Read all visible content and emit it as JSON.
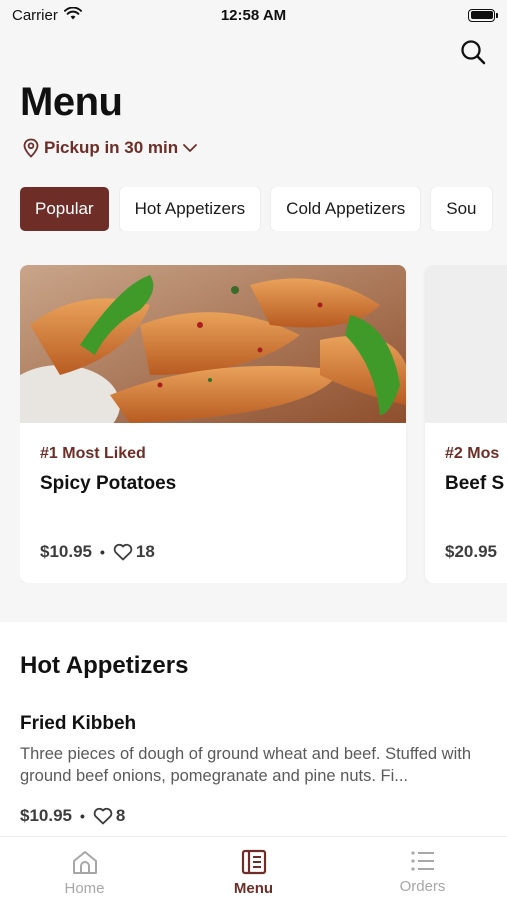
{
  "status_bar": {
    "carrier": "Carrier",
    "time": "12:58 AM",
    "battery_level": 1.0
  },
  "header": {
    "title": "Menu",
    "pickup_text": "Pickup in 30 min",
    "search_icon": "search-icon",
    "pickup_icon": "location-pin-icon"
  },
  "categories": [
    {
      "label": "Popular",
      "active": true
    },
    {
      "label": "Hot Appetizers",
      "active": false
    },
    {
      "label": "Cold Appetizers",
      "active": false
    },
    {
      "label": "Sou",
      "active": false
    }
  ],
  "featured": [
    {
      "rank": "#1 Most Liked",
      "name": "Spicy Potatoes",
      "price": "$10.95",
      "separator": "•",
      "likes": "18"
    },
    {
      "rank": "#2 Mos",
      "name": "Beef S",
      "price": "$20.95"
    }
  ],
  "section": {
    "title": "Hot Appetizers",
    "items": [
      {
        "name": "Fried Kibbeh",
        "description": "Three pieces of dough of ground wheat and beef. Stuffed with ground beef onions, pomegranate and pine nuts. Fi...",
        "price": "$10.95",
        "separator": "•",
        "likes": "8"
      }
    ]
  },
  "tabs": [
    {
      "label": "Home",
      "icon": "home-icon",
      "active": false
    },
    {
      "label": "Menu",
      "icon": "menu-book-icon",
      "active": true
    },
    {
      "label": "Orders",
      "icon": "list-icon",
      "active": false
    }
  ],
  "colors": {
    "accent": "#6e2e27",
    "background": "#f6f6f6",
    "inactive_tab": "#a7a7a7"
  }
}
